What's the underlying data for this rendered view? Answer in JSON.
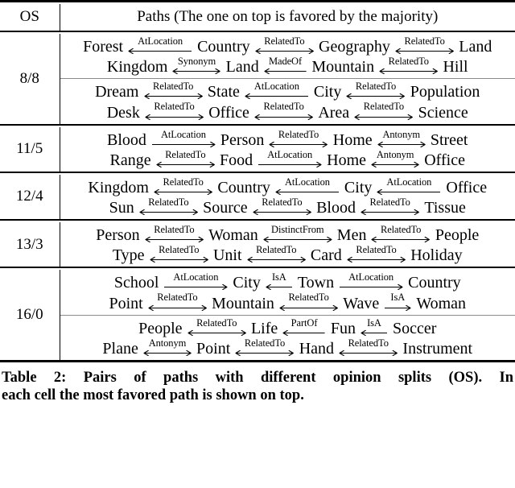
{
  "table": {
    "header": {
      "os_label": "OS",
      "paths_label": "Paths (The one on top is favored by the majority)"
    },
    "rows": [
      {
        "os": "8/8",
        "blocks": [
          {
            "lines": [
              {
                "nodes": [
                  "Forest",
                  "Country",
                  "Geography",
                  "Land"
                ],
                "edges": [
                  {
                    "label": "AtLocation",
                    "dir": "left"
                  },
                  {
                    "label": "RelatedTo",
                    "dir": "both"
                  },
                  {
                    "label": "RelatedTo",
                    "dir": "both"
                  }
                ]
              },
              {
                "nodes": [
                  "Kingdom",
                  "Land",
                  "Mountain",
                  "Hill"
                ],
                "edges": [
                  {
                    "label": "Synonym",
                    "dir": "both"
                  },
                  {
                    "label": "MadeOf",
                    "dir": "left"
                  },
                  {
                    "label": "RelatedTo",
                    "dir": "both"
                  }
                ]
              }
            ]
          },
          {
            "lines": [
              {
                "nodes": [
                  "Dream",
                  "State",
                  "City",
                  "Population"
                ],
                "edges": [
                  {
                    "label": "RelatedTo",
                    "dir": "both"
                  },
                  {
                    "label": "AtLocation",
                    "dir": "left"
                  },
                  {
                    "label": "RelatedTo",
                    "dir": "both"
                  }
                ]
              },
              {
                "nodes": [
                  "Desk",
                  "Office",
                  "Area",
                  "Science"
                ],
                "edges": [
                  {
                    "label": "RelatedTo",
                    "dir": "both"
                  },
                  {
                    "label": "RelatedTo",
                    "dir": "both"
                  },
                  {
                    "label": "RelatedTo",
                    "dir": "both"
                  }
                ]
              }
            ]
          }
        ]
      },
      {
        "os": "11/5",
        "blocks": [
          {
            "lines": [
              {
                "nodes": [
                  "Blood",
                  "Person",
                  "Home",
                  "Street"
                ],
                "edges": [
                  {
                    "label": "AtLocation",
                    "dir": "right"
                  },
                  {
                    "label": "RelatedTo",
                    "dir": "both"
                  },
                  {
                    "label": "Antonym",
                    "dir": "both"
                  }
                ]
              },
              {
                "nodes": [
                  "Range",
                  "Food",
                  "Home",
                  "Office"
                ],
                "edges": [
                  {
                    "label": "RelatedTo",
                    "dir": "both"
                  },
                  {
                    "label": "AtLocation",
                    "dir": "right"
                  },
                  {
                    "label": "Antonym",
                    "dir": "both"
                  }
                ]
              }
            ]
          }
        ]
      },
      {
        "os": "12/4",
        "blocks": [
          {
            "lines": [
              {
                "nodes": [
                  "Kingdom",
                  "Country",
                  "City",
                  "Office"
                ],
                "edges": [
                  {
                    "label": "RelatedTo",
                    "dir": "both"
                  },
                  {
                    "label": "AtLocation",
                    "dir": "left"
                  },
                  {
                    "label": "AtLocation",
                    "dir": "left"
                  }
                ]
              },
              {
                "nodes": [
                  "Sun",
                  "Source",
                  "Blood",
                  "Tissue"
                ],
                "edges": [
                  {
                    "label": "RelatedTo",
                    "dir": "both"
                  },
                  {
                    "label": "RelatedTo",
                    "dir": "both"
                  },
                  {
                    "label": "RelatedTo",
                    "dir": "both"
                  }
                ]
              }
            ]
          }
        ]
      },
      {
        "os": "13/3",
        "blocks": [
          {
            "lines": [
              {
                "nodes": [
                  "Person",
                  "Woman",
                  "Men",
                  "People"
                ],
                "edges": [
                  {
                    "label": "RelatedTo",
                    "dir": "both"
                  },
                  {
                    "label": "DistinctFrom",
                    "dir": "both"
                  },
                  {
                    "label": "RelatedTo",
                    "dir": "both"
                  }
                ]
              },
              {
                "nodes": [
                  "Type",
                  "Unit",
                  "Card",
                  "Holiday"
                ],
                "edges": [
                  {
                    "label": "RelatedTo",
                    "dir": "both"
                  },
                  {
                    "label": "RelatedTo",
                    "dir": "both"
                  },
                  {
                    "label": "RelatedTo",
                    "dir": "both"
                  }
                ]
              }
            ]
          }
        ]
      },
      {
        "os": "16/0",
        "blocks": [
          {
            "lines": [
              {
                "nodes": [
                  "School",
                  "City",
                  "Town",
                  "Country"
                ],
                "edges": [
                  {
                    "label": "AtLocation",
                    "dir": "right"
                  },
                  {
                    "label": "IsA",
                    "dir": "left"
                  },
                  {
                    "label": "AtLocation",
                    "dir": "right"
                  }
                ]
              },
              {
                "nodes": [
                  "Point",
                  "Mountain",
                  "Wave",
                  "Woman"
                ],
                "edges": [
                  {
                    "label": "RelatedTo",
                    "dir": "both"
                  },
                  {
                    "label": "RelatedTo",
                    "dir": "both"
                  },
                  {
                    "label": "IsA",
                    "dir": "right"
                  }
                ]
              }
            ]
          },
          {
            "lines": [
              {
                "nodes": [
                  "People",
                  "Life",
                  "Fun",
                  "Soccer"
                ],
                "edges": [
                  {
                    "label": "RelatedTo",
                    "dir": "both"
                  },
                  {
                    "label": "PartOf",
                    "dir": "left"
                  },
                  {
                    "label": "IsA",
                    "dir": "left"
                  }
                ]
              },
              {
                "nodes": [
                  "Plane",
                  "Point",
                  "Hand",
                  "Instrument"
                ],
                "edges": [
                  {
                    "label": "Antonym",
                    "dir": "both"
                  },
                  {
                    "label": "RelatedTo",
                    "dir": "both"
                  },
                  {
                    "label": "RelatedTo",
                    "dir": "both"
                  }
                ]
              }
            ]
          }
        ]
      }
    ]
  },
  "caption": {
    "line1": "Table 2: Pairs of paths with different opinion splits (OS). In",
    "line2": "each cell the most favored path is shown on top."
  }
}
